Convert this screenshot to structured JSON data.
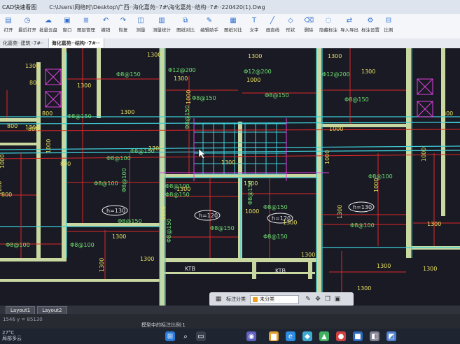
{
  "window": {
    "app_title": "CAD快速看图",
    "file_path": "C:\\Users\\网络时\\Desktop\\广西··海化嘉苑··7#\\海化嘉苑··结构··7#··220420(1).Dwg"
  },
  "toolbar": [
    {
      "label": "打开",
      "icon": "folder-icon"
    },
    {
      "label": "最近打开",
      "icon": "recent-icon"
    },
    {
      "label": "批量云盘",
      "icon": "cloud-icon"
    },
    {
      "label": "窗口",
      "icon": "window-icon"
    },
    {
      "label": "图层管理",
      "icon": "layers-icon"
    },
    {
      "label": "撤销",
      "icon": "undo-icon"
    },
    {
      "label": "恢复",
      "icon": "redo-icon"
    },
    {
      "label": "测量",
      "icon": "ruler-icon"
    },
    {
      "label": "测量统计",
      "icon": "measure-stats-icon"
    },
    {
      "label": "图纸对比",
      "icon": "compare-icon"
    },
    {
      "label": "编辑助手",
      "icon": "edit-assistant-icon"
    },
    {
      "label": "图纸对比",
      "icon": "compare2-icon"
    },
    {
      "label": "文字",
      "icon": "text-icon"
    },
    {
      "label": "画直线",
      "icon": "line-icon"
    },
    {
      "label": "形状",
      "icon": "shape-icon"
    },
    {
      "label": "删除",
      "icon": "erase-icon"
    },
    {
      "label": "隐藏标注",
      "icon": "hide-annotation-icon"
    },
    {
      "label": "导入导出",
      "icon": "import-export-icon"
    },
    {
      "label": "标注设置",
      "icon": "annotation-settings-icon"
    },
    {
      "label": "比例",
      "icon": "scale-icon"
    }
  ],
  "tabs": [
    {
      "label": "化嘉苑··建筑··7#··",
      "active": false
    },
    {
      "label": "海化嘉苑··结构··7#··",
      "active": true
    }
  ],
  "drawing": {
    "bar_labels": [
      "Φ12@200",
      "Φ12@200",
      "Φ12@200",
      "Φ8@150",
      "Φ8@150",
      "Φ8@150",
      "Φ8@150",
      "Φ8@150",
      "Φ8@150",
      "Φ8@150",
      "Φ8@100",
      "Φ8@100",
      "Φ8@100",
      "Φ8@100",
      "Φ8@100",
      "Φ8@150",
      "Φ8@150",
      "Φ8@150",
      "Φ8@150",
      "Φ8@150",
      "Φ8@100",
      "Φ8@150",
      "Φ8@100",
      "Φ8@100",
      "Φ8@150"
    ],
    "dims_1300": [
      "1300",
      "1300",
      "1300",
      "1300",
      "1300",
      "1300",
      "1300",
      "1300",
      "1300",
      "1300",
      "1300",
      "1300",
      "1300",
      "1300",
      "1300",
      "1300",
      "1300",
      "1300",
      "1300",
      "1300",
      "1300",
      "1300",
      "1300"
    ],
    "dims_1000": [
      "1000",
      "1000",
      "1000",
      "1000",
      "1000",
      "1000",
      "1000",
      "1000",
      "1000",
      "1000",
      "1000"
    ],
    "dims_800": [
      "800",
      "800",
      "800",
      "800",
      "800",
      "800",
      "800"
    ],
    "slab_thickness": [
      "h=130",
      "h=120",
      "h=120",
      "h=130"
    ],
    "ktb": [
      "KTB",
      "KTB"
    ]
  },
  "layouts": [
    "Layout1",
    "Layout2"
  ],
  "status": {
    "coords": "1546 y = 85130",
    "prompt": "模型中的标注比例:1"
  },
  "floatbar": {
    "label": "标注分类",
    "selected": "未分类"
  },
  "taskbar": {
    "temp": "27°C",
    "weather": "局部多云"
  },
  "colors": {
    "canvas": "#191a24",
    "wall": "#c9d8a0",
    "green_text": "#6fe070",
    "yellow_text": "#e8e060",
    "red_line": "#e02828",
    "cyan_line": "#3fd0d8",
    "magenta_line": "#e040e0"
  }
}
